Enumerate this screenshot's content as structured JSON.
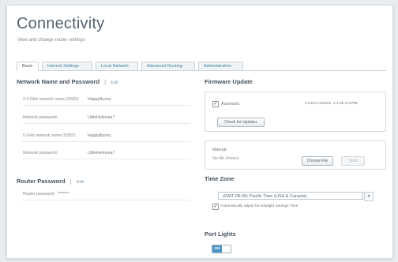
{
  "page": {
    "title": "Connectivity",
    "subtitle": "View and change router settings"
  },
  "tabs": [
    {
      "label": "Basic",
      "active": true
    },
    {
      "label": "Internet Settings",
      "active": false
    },
    {
      "label": "Local Network",
      "active": false
    },
    {
      "label": "Advanced Routing",
      "active": false
    },
    {
      "label": "Administration",
      "active": false
    }
  ],
  "network": {
    "title": "Network Name and Password",
    "edit": "Edit",
    "rows": [
      {
        "label": "2.4 GHz network name (SSID):",
        "value": "HappyBunny"
      },
      {
        "label": "Network password:",
        "value": "LittleHelmsea7"
      },
      {
        "label": "5 GHz network name (SSID):",
        "value": "HappyBunny"
      },
      {
        "label": "Network password:",
        "value": "LittleHelmsea7"
      }
    ]
  },
  "router_password": {
    "title": "Router Password",
    "edit": "Edit",
    "label": "Router password:",
    "value": "*******"
  },
  "firmware": {
    "title": "Firmware Update",
    "automatic_label": "Automatic",
    "automatic_checked": true,
    "current_version": "Current Version: 1.1.00.172796",
    "check_button": "Check for Updates",
    "manual_label": "Manual:",
    "no_file": "No file chosen",
    "choose_button": "Choose File",
    "start_button": "Start"
  },
  "time_zone": {
    "title": "Time Zone",
    "selected": "(GMT-08:00) Pacific Time (USA & Canada)",
    "dst_label": "Automatically adjust for Daylight Savings Time",
    "dst_checked": true
  },
  "port_lights": {
    "title": "Port Lights",
    "state": "ON"
  },
  "colors": {
    "accent": "#4a93c8",
    "title_text": "#56626d",
    "border": "#d6dde3"
  },
  "icons": {
    "checkmark": "checkmark-icon",
    "select_arrow": "chevron-down-icon"
  }
}
